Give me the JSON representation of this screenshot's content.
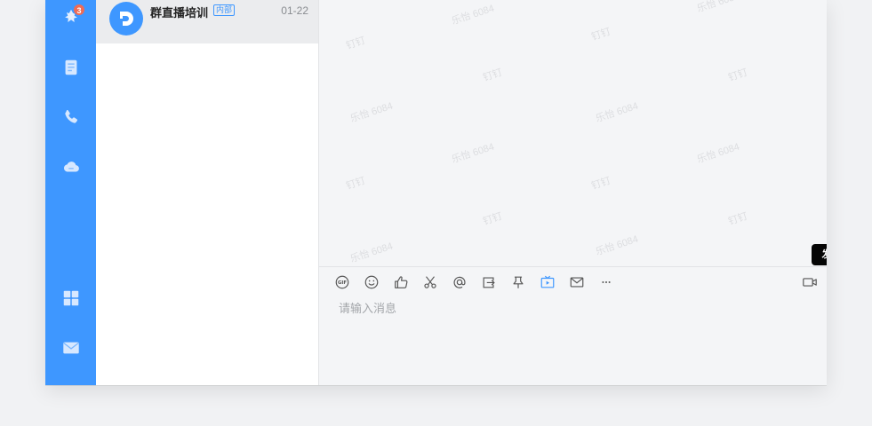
{
  "sidebar": {
    "items": [
      {
        "icon": "ding-icon",
        "badge": "3"
      },
      {
        "icon": "contacts-icon"
      },
      {
        "icon": "phone-icon"
      },
      {
        "icon": "cloud-icon"
      },
      {
        "icon": "apps-grid-icon"
      },
      {
        "icon": "mail-icon"
      }
    ]
  },
  "conversation": {
    "name": "群直播培训",
    "tag": "内部",
    "time": "01-22"
  },
  "watermark": {
    "text_a": "乐怡 6084",
    "text_b": "钉钉"
  },
  "toolbar": {
    "buttons": [
      "gif-icon",
      "emoji-icon",
      "thumbs-up-icon",
      "scissors-icon",
      "at-icon",
      "forward-icon",
      "pin-icon",
      "live-broadcast-icon",
      "mail-icon",
      "more-icon",
      "video-call-icon"
    ],
    "tooltip": "发起群直播"
  },
  "input": {
    "placeholder": "请输入消息"
  },
  "colors": {
    "accent": "#3e97ff",
    "sidebar": "#3e97ff",
    "badge": "#f06b54"
  }
}
